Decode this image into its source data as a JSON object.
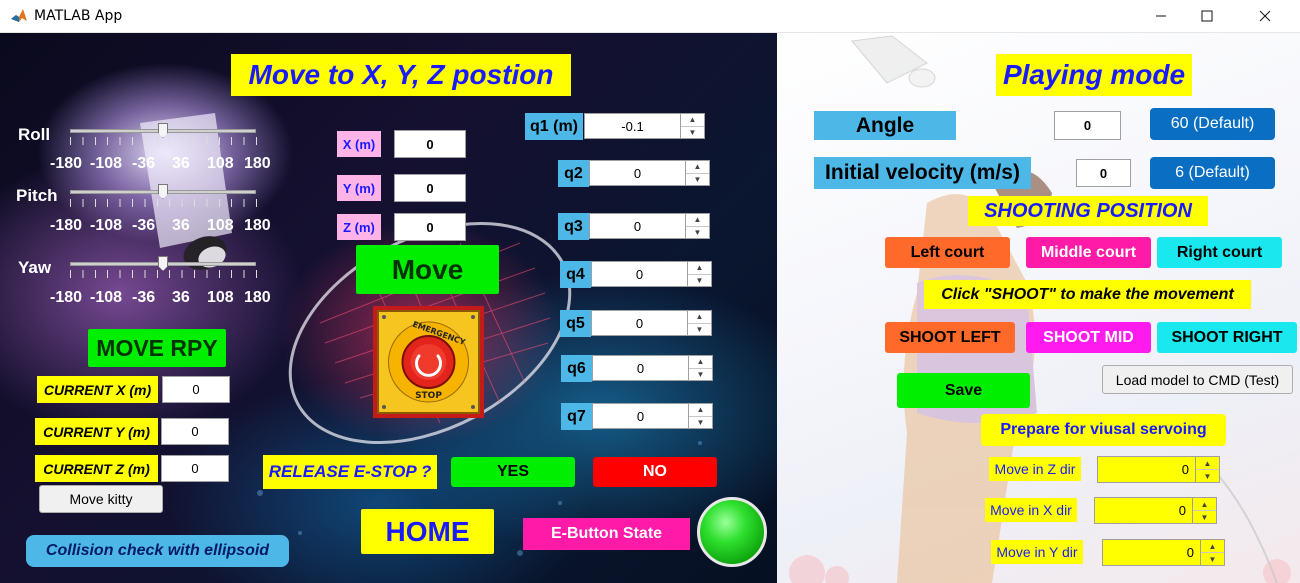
{
  "window": {
    "title": "MATLAB App"
  },
  "left": {
    "heading": "Move to X, Y, Z postion",
    "sliders": [
      {
        "name": "Roll",
        "value": 0
      },
      {
        "name": "Pitch",
        "value": 0
      },
      {
        "name": "Yaw",
        "value": 0
      }
    ],
    "tick_labels": [
      "-180",
      "-108",
      "-36",
      "36",
      "108",
      "180"
    ],
    "xyz": [
      {
        "label": "X (m)",
        "value": "0"
      },
      {
        "label": "Y (m)",
        "value": "0"
      },
      {
        "label": "Z (m)",
        "value": "0"
      }
    ],
    "move_button": "Move",
    "move_rpy_button": "MOVE RPY",
    "current": [
      {
        "label": "CURRENT X (m)",
        "value": "0"
      },
      {
        "label": "CURRENT Y  (m)",
        "value": "0"
      },
      {
        "label": "CURRENT Z  (m)",
        "value": "0"
      }
    ],
    "move_kitty_button": "Move kitty",
    "collision_label": "Collision check with ellipsoid",
    "joints": [
      {
        "label": "q1 (m)",
        "value": "-0.1"
      },
      {
        "label": "q2",
        "value": "0"
      },
      {
        "label": "q3",
        "value": "0"
      },
      {
        "label": "q4",
        "value": "0"
      },
      {
        "label": "q5",
        "value": "0"
      },
      {
        "label": "q6",
        "value": "0"
      },
      {
        "label": "q7",
        "value": "0"
      }
    ],
    "emergency": {
      "top": "EMERGENCY",
      "bottom": "STOP"
    },
    "release_label": "RELEASE E-STOP ?",
    "yes_button": "YES",
    "no_button": "NO",
    "home_button": "HOME",
    "ebutton_state_label": "E-Button State",
    "lamp_color": "#22cc22"
  },
  "right": {
    "heading": "Playing mode",
    "angle": {
      "label": "Angle",
      "value": "0",
      "default_button": "60 (Default)"
    },
    "velocity": {
      "label": "Initial velocity (m/s)",
      "value": "0",
      "default_button": "6 (Default)"
    },
    "shooting_position": "SHOOTING POSITION",
    "courts": [
      "Left court",
      "Middle court",
      "Right court"
    ],
    "shoot_hint": "Click \"SHOOT\" to make the movement",
    "shoots": [
      "SHOOT LEFT",
      "SHOOT MID",
      "SHOOT RIGHT"
    ],
    "save_button": "Save",
    "load_model_button": "Load model to CMD (Test)",
    "visual_servoing_label": "Prepare for viusal servoing",
    "moves": [
      {
        "label": "Move in Z dir",
        "value": "0"
      },
      {
        "label": "Move in X dir",
        "value": "0"
      },
      {
        "label": "Move in Y dir",
        "value": "0"
      }
    ]
  },
  "colors": {
    "accent_yellow": "#ffff00",
    "text_blue": "#1a1aff",
    "green": "#00ee00",
    "red": "#ff0000",
    "blue_button": "#0a6fc2",
    "orange": "#ff6a2a",
    "magenta": "#ff1aa8",
    "cyan": "#19e8ee"
  }
}
